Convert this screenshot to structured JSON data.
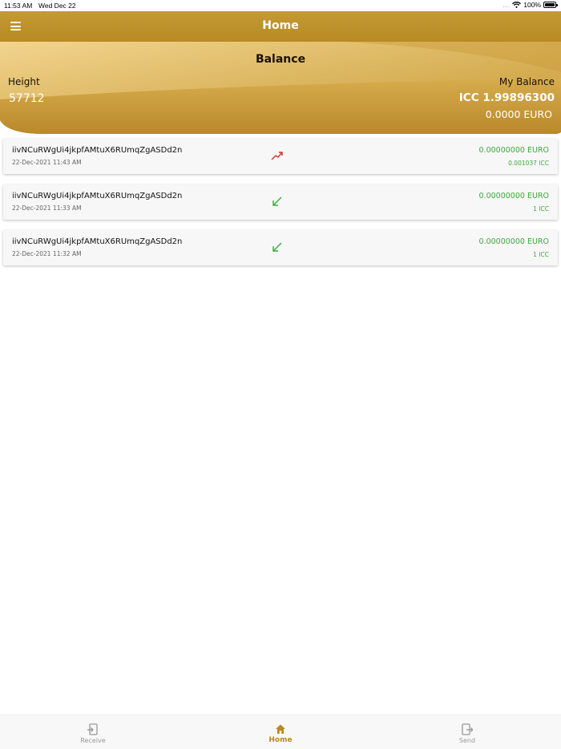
{
  "status_bar": {
    "time": "11:53 AM",
    "date": "Wed Dec 22",
    "signal": "....",
    "battery": "100%"
  },
  "nav": {
    "title": "Home"
  },
  "balance": {
    "title": "Balance",
    "height_label": "Height",
    "height_value": "57712",
    "my_balance_label": "My Balance",
    "icc_value": "ICC 1.99896300",
    "euro_value": "0.0000 EURO"
  },
  "transactions": [
    {
      "address": "iivNCuRWgUi4jkpfAMtuX6RUmqZgASDd2n",
      "date": "22-Dec-2021 11:43 AM",
      "direction": "sent",
      "arrow_icon": "trending-up-arrow-icon",
      "arrow_color": "#d0312d",
      "euro": "0.00000000 EURO",
      "icc": "0.001037 ICC"
    },
    {
      "address": "iivNCuRWgUi4jkpfAMtuX6RUmqZgASDd2n",
      "date": "22-Dec-2021 11:33 AM",
      "direction": "received",
      "arrow_icon": "arrow-down-left-icon",
      "arrow_color": "#3caa3c",
      "euro": "0.00000000 EURO",
      "icc": "1 ICC"
    },
    {
      "address": "iivNCuRWgUi4jkpfAMtuX6RUmqZgASDd2n",
      "date": "22-Dec-2021 11:32 AM",
      "direction": "received",
      "arrow_icon": "arrow-down-left-icon",
      "arrow_color": "#3caa3c",
      "euro": "0.00000000 EURO",
      "icc": "1 ICC"
    }
  ],
  "tabs": [
    {
      "label": "Receive",
      "icon": "receive-icon",
      "active": false
    },
    {
      "label": "Home",
      "icon": "home-icon",
      "active": true
    },
    {
      "label": "Send",
      "icon": "send-icon",
      "active": false
    }
  ],
  "colors": {
    "brand_gold": "#b88a24",
    "header_gold_light": "#f2d48e",
    "positive_green": "#3caa3c",
    "negative_red": "#d0312d"
  }
}
